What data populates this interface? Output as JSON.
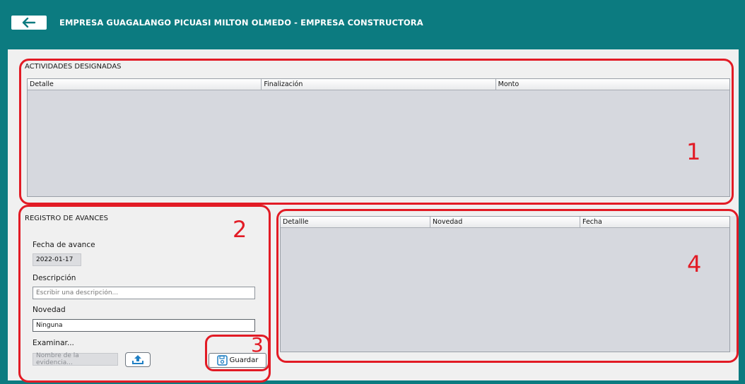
{
  "header": {
    "title": "EMPRESA GUAGALANGO PICUASI MILTON OLMEDO - EMPRESA CONSTRUCTORA",
    "back_icon": "arrow-left-icon"
  },
  "activities": {
    "section_title": "ACTIVIDADES DESIGNADAS",
    "columns": [
      "Detalle",
      "Finalización",
      "Monto"
    ],
    "rows": []
  },
  "progress_form": {
    "section_title": "REGISTRO DE AVANCES",
    "date_label": "Fecha de avance",
    "date_value": "2022-01-17",
    "description_label": "Descripción",
    "description_placeholder": "Escribir una descripción...",
    "description_value": "",
    "novelty_label": "Novedad",
    "novelty_value": "Ninguna",
    "browse_label": "Examinar...",
    "evidence_placeholder": "Nombre de la evidencia...",
    "upload_icon": "upload-icon",
    "save_label": "Guardar",
    "save_icon": "floppy-disk-icon"
  },
  "progress_table": {
    "columns": [
      "Detallle",
      "Novedad",
      "Fecha"
    ],
    "rows": []
  },
  "annotations": {
    "n1": "1",
    "n2": "2",
    "n3": "3",
    "n4": "4",
    "color": "#e21b25"
  },
  "colors": {
    "header_bg": "#0c7b80",
    "panel_bg": "#f0f0f0",
    "table_body": "#d6d8de",
    "accent_blue": "#1f7fc4"
  }
}
